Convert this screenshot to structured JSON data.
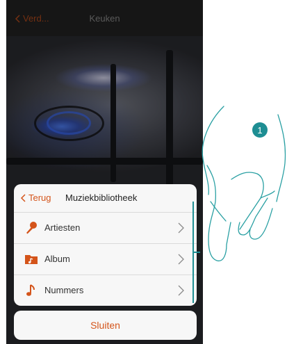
{
  "header": {
    "back_label": "Verd...",
    "title": "Keuken"
  },
  "sheet": {
    "back_label": "Terug",
    "title": "Muziekbibliotheek",
    "items": [
      {
        "label": "Artiesten",
        "icon": "microphone-icon"
      },
      {
        "label": "Album",
        "icon": "album-icon"
      },
      {
        "label": "Nummers",
        "icon": "music-note-icon"
      }
    ]
  },
  "close_label": "Sluiten",
  "annotation": {
    "step": "1"
  },
  "colors": {
    "accent": "#d4541a",
    "badge": "#1e8e93"
  }
}
